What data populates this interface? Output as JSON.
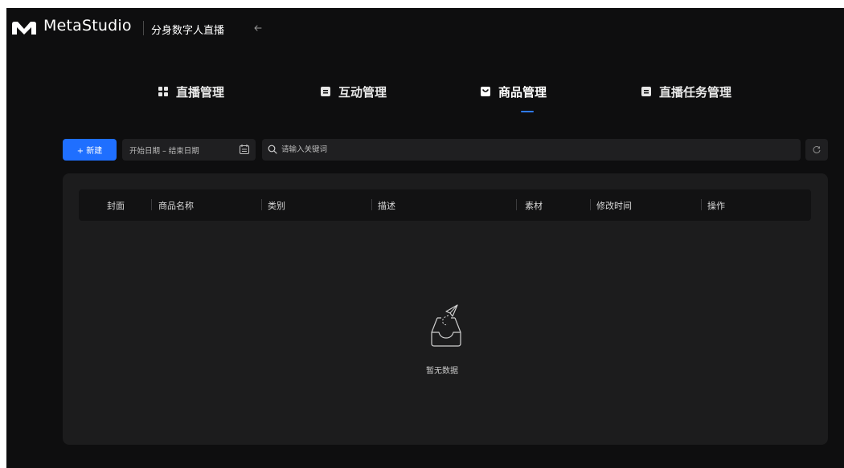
{
  "header": {
    "brand": "MetaStudio",
    "product": "分身数字人直播",
    "back_icon": "arrow-left-icon"
  },
  "tabs": [
    {
      "label": "直播管理",
      "icon": "grid-icon",
      "active": false
    },
    {
      "label": "互动管理",
      "icon": "document-icon",
      "active": false
    },
    {
      "label": "商品管理",
      "icon": "shopping-bag-icon",
      "active": true
    },
    {
      "label": "直播任务管理",
      "icon": "document-icon",
      "active": false
    }
  ],
  "toolbar": {
    "new_button": "+ 新建",
    "date_range": "开始日期 – 结束日期",
    "search_placeholder": "请输入关键词",
    "search_value": ""
  },
  "table": {
    "columns": [
      "封面",
      "商品名称",
      "类别",
      "描述",
      "素材",
      "修改时间",
      "操作"
    ],
    "rows": []
  },
  "empty": {
    "text": "暂无数据",
    "icon": "empty-inbox-icon"
  },
  "colors": {
    "background": "#0e0e0f",
    "panel": "#1c1c1d",
    "accent": "#1f6fff"
  }
}
